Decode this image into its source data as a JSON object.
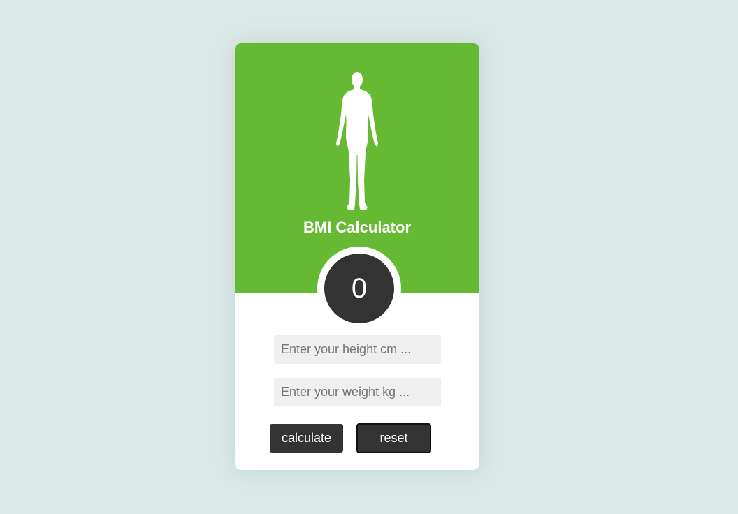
{
  "app": {
    "title": "BMI Calculator"
  },
  "result": {
    "value": "0"
  },
  "inputs": {
    "height": {
      "value": "",
      "placeholder": "Enter your height cm ..."
    },
    "weight": {
      "value": "",
      "placeholder": "Enter your weight kg ..."
    }
  },
  "buttons": {
    "calculate_label": "calculate",
    "reset_label": "reset"
  },
  "icons": {
    "header_illustration": "human-body-icon"
  },
  "colors": {
    "header": "#66b933",
    "dark": "#333333",
    "page_background": "#dbe8e8",
    "input_background": "#efefef"
  }
}
